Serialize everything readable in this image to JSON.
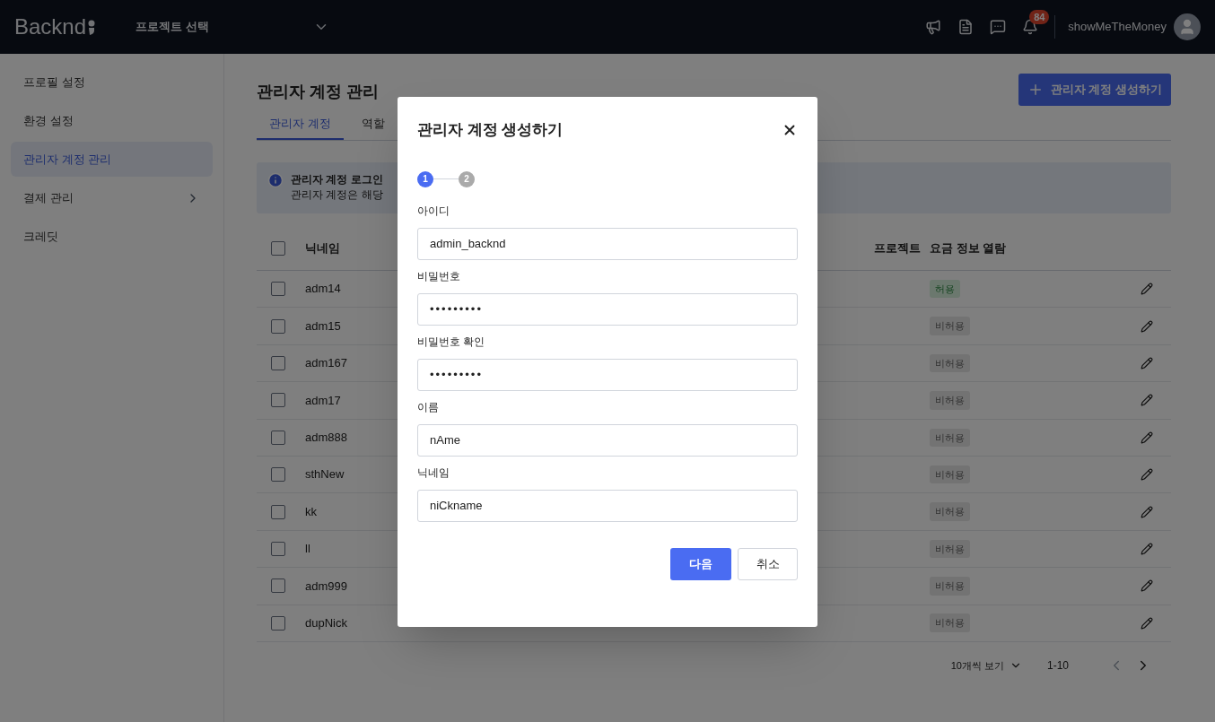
{
  "header": {
    "logo": "Backnd",
    "project_select": "프로젝트 선택",
    "notification_count": "84",
    "username": "showMeTheMoney"
  },
  "sidebar": {
    "items": [
      {
        "label": "프로필 설정",
        "selected": false,
        "has_submenu": false
      },
      {
        "label": "환경 설정",
        "selected": false,
        "has_submenu": false
      },
      {
        "label": "관리자 계정 관리",
        "selected": true,
        "has_submenu": false
      },
      {
        "label": "결제 관리",
        "selected": false,
        "has_submenu": true
      },
      {
        "label": "크레딧",
        "selected": false,
        "has_submenu": false
      }
    ]
  },
  "page": {
    "title": "관리자 계정 관리",
    "create_button": "관리자 계정 생성하기",
    "tabs": [
      {
        "label": "관리자 계정",
        "selected": true
      },
      {
        "label": "역할",
        "selected": false
      }
    ],
    "notice": {
      "title": "관리자 계정 로그인",
      "body": "관리자 계정은 해당"
    }
  },
  "table": {
    "header_checked": false,
    "columns": [
      "닉네임",
      "프로젝트",
      "요금 정보 열람"
    ],
    "rows": [
      {
        "nickname": "adm14",
        "checked": false,
        "billing": {
          "label": "허용",
          "allowed": true
        }
      },
      {
        "nickname": "adm15",
        "checked": false,
        "billing": {
          "label": "비허용",
          "allowed": false
        }
      },
      {
        "nickname": "adm167",
        "checked": false,
        "billing": {
          "label": "비허용",
          "allowed": false
        }
      },
      {
        "nickname": "adm17",
        "checked": false,
        "billing": {
          "label": "비허용",
          "allowed": false
        }
      },
      {
        "nickname": "adm888",
        "checked": false,
        "billing": {
          "label": "비허용",
          "allowed": false
        }
      },
      {
        "nickname": "sthNew",
        "checked": false,
        "billing": {
          "label": "비허용",
          "allowed": false
        }
      },
      {
        "nickname": "kk",
        "checked": false,
        "billing": {
          "label": "비허용",
          "allowed": false
        }
      },
      {
        "nickname": "ll",
        "checked": false,
        "billing": {
          "label": "비허용",
          "allowed": false
        }
      },
      {
        "nickname": "adm999",
        "checked": false,
        "billing": {
          "label": "비허용",
          "allowed": false
        }
      },
      {
        "nickname": "dupNick",
        "checked": false,
        "billing": {
          "label": "비허용",
          "allowed": false
        }
      }
    ]
  },
  "pagination": {
    "page_size": "10개씩 보기",
    "range": "1-10"
  },
  "dialog": {
    "title": "관리자 계정 생성하기",
    "steps": [
      {
        "label": "1",
        "selected": true
      },
      {
        "label": "2",
        "selected": false
      }
    ],
    "fields": [
      {
        "label": "아이디",
        "value": "admin_backnd",
        "kind": "text"
      },
      {
        "label": "비밀번호",
        "value": "•••••••••",
        "kind": "password"
      },
      {
        "label": "비밀번호 확인",
        "value": "•••••••••",
        "kind": "password"
      },
      {
        "label": "이름",
        "value": "nAme",
        "kind": "text"
      },
      {
        "label": "닉네임",
        "value": "niCkname",
        "kind": "text"
      }
    ],
    "primary_button": "다음",
    "cancel_button": "취소"
  }
}
